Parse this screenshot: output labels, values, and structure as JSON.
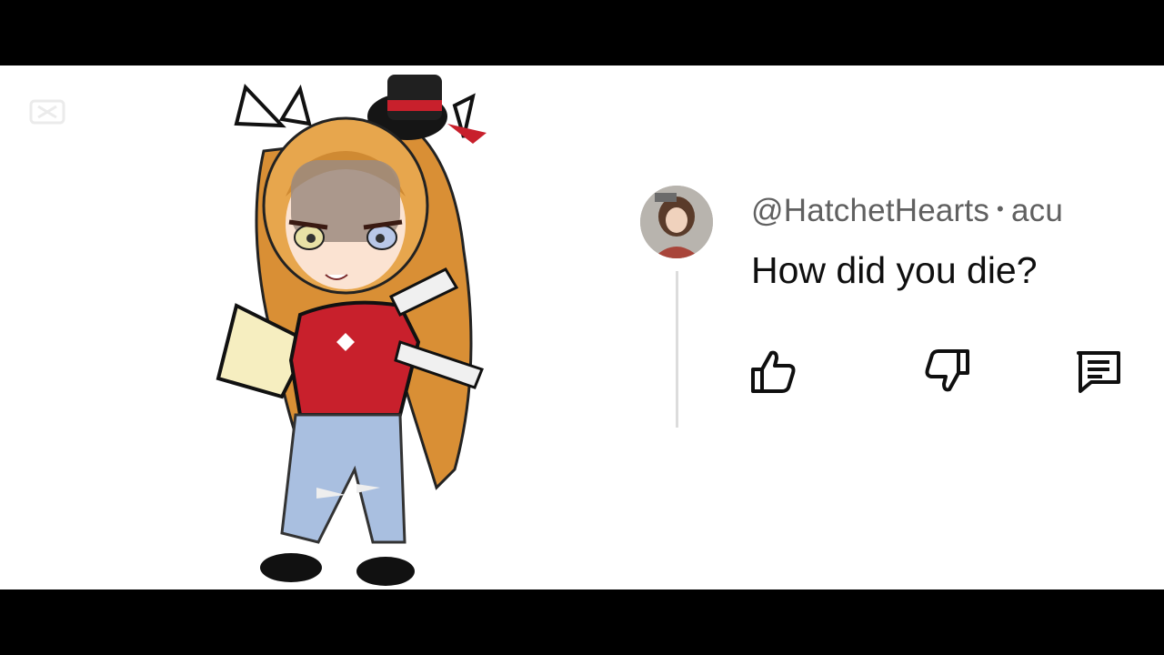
{
  "comment": {
    "author": "@HatchetHearts",
    "separator": "•",
    "time": "acu",
    "text": "How did you die?",
    "avatar_icon": "user-avatar"
  },
  "actions": {
    "like_icon": "thumbs-up-icon",
    "dislike_icon": "thumbs-down-icon",
    "reply_icon": "comment-reply-icon"
  },
  "colors": {
    "background": "#ffffff",
    "letterbox": "#000000",
    "meta_text": "#606060",
    "body_text": "#0f0f0f",
    "character_shirt": "#c8202c",
    "character_hair": "#e0a24a",
    "character_jeans": "#a9bfe0"
  }
}
